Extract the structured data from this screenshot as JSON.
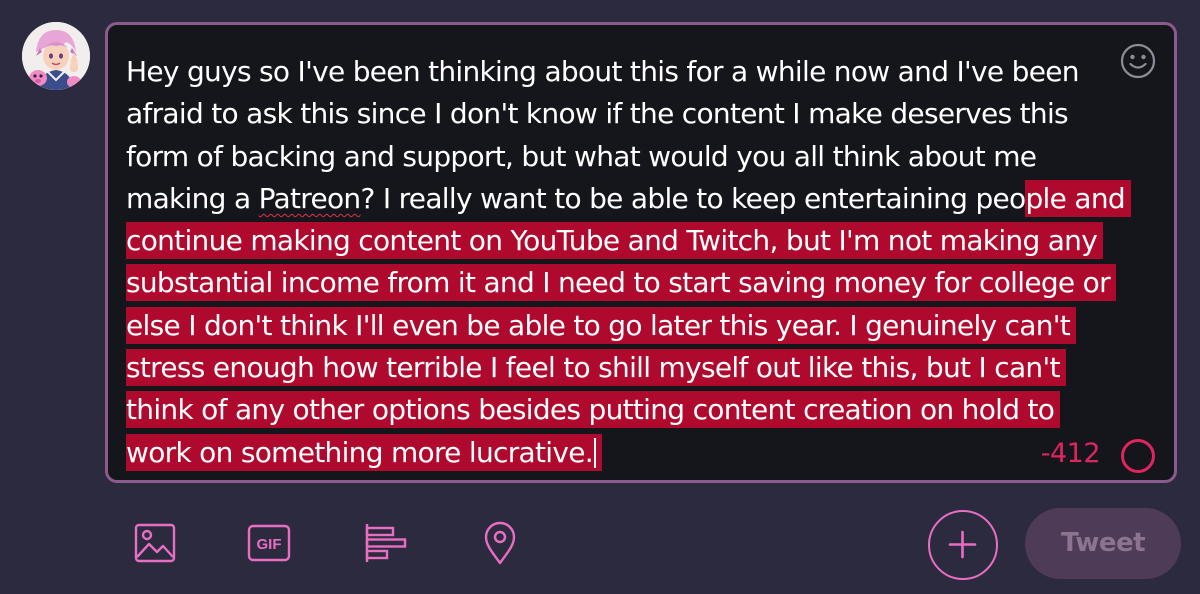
{
  "compose": {
    "text_before_overflow": "Hey guys so I've been thinking about this for a while now and I've been afraid to ask this since I don't know if the content I make deserves this form of backing and support, but what would you all think about me making a ",
    "misspelled_word": "Patreon",
    "text_mid": "? I really want to be able to keep entertaining peo",
    "text_overflow": "ple and continue making content on YouTube and Twitch, but I'm not making any substantial income from it and I need to start saving money for college or else I don't think I'll even be able to go later this year. I genuinely can't stress enough how terrible I feel to shill myself out like this, but I can't think of any other options besides putting content creation on hold to work on something more lucrative.",
    "remaining_characters": "-412"
  },
  "actions": {
    "tweet_label": "Tweet"
  },
  "icons": {
    "emoji": "smiley-icon",
    "media": "image-icon",
    "gif": "gif-icon",
    "poll": "poll-icon",
    "location": "location-pin-icon",
    "add": "plus-icon",
    "progress": "character-count-ring-icon"
  },
  "colors": {
    "background": "#2c2a3e",
    "composer_background": "#15161c",
    "composer_border": "#8c5a8c",
    "accent": "#e86ec4",
    "overflow_highlight": "#b0092e",
    "over_limit": "#e0245e",
    "tweet_button_disabled": "#4e3b58"
  }
}
